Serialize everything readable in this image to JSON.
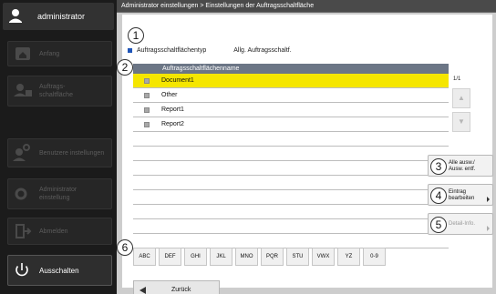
{
  "sidebar": {
    "user": "administrator",
    "items": [
      {
        "label": "Anfang",
        "icon": "home-icon"
      },
      {
        "label": "Auftrags-\nschaltfläche",
        "icon": "job-button-icon"
      },
      {
        "label": "Benutzere instellungen",
        "icon": "user-settings-icon"
      },
      {
        "label": "Administrator\neinstellung",
        "icon": "admin-settings-icon"
      },
      {
        "label": "Abmelden",
        "icon": "logout-icon"
      },
      {
        "label": "Ausschalten",
        "icon": "power-icon"
      }
    ]
  },
  "breadcrumb": "Administrator einstellungen > Einstellungen der Auftragsschaltfläche",
  "markers": [
    "1",
    "2",
    "3",
    "4",
    "5",
    "6"
  ],
  "type_row": {
    "label": "Auftragsschaltflächentyp",
    "value": "Allg. Auftragsschaltf."
  },
  "table": {
    "header": "Auftragsschaltflächenname",
    "rows": [
      "Document1",
      "Other",
      "Report1",
      "Report2"
    ],
    "empty_rows": 8
  },
  "pager": {
    "text": "1/1",
    "up_icon": "triangle-up-icon",
    "down_icon": "triangle-down-icon"
  },
  "side_buttons": {
    "select_all": "Alle ausw./\nAusw. entf.",
    "edit": "Eintrag\nbearbeiten",
    "detail": "Detail-Info."
  },
  "alpha": [
    "ABC",
    "DEF",
    "GHI",
    "JKL",
    "MNO",
    "PQR",
    "STU",
    "VWX",
    "YZ",
    "0-9"
  ],
  "back": "Zurück",
  "colors": {
    "selected_row": "#f5e600",
    "accent_square": "#1f55b8",
    "table_header": "#6c7686"
  }
}
